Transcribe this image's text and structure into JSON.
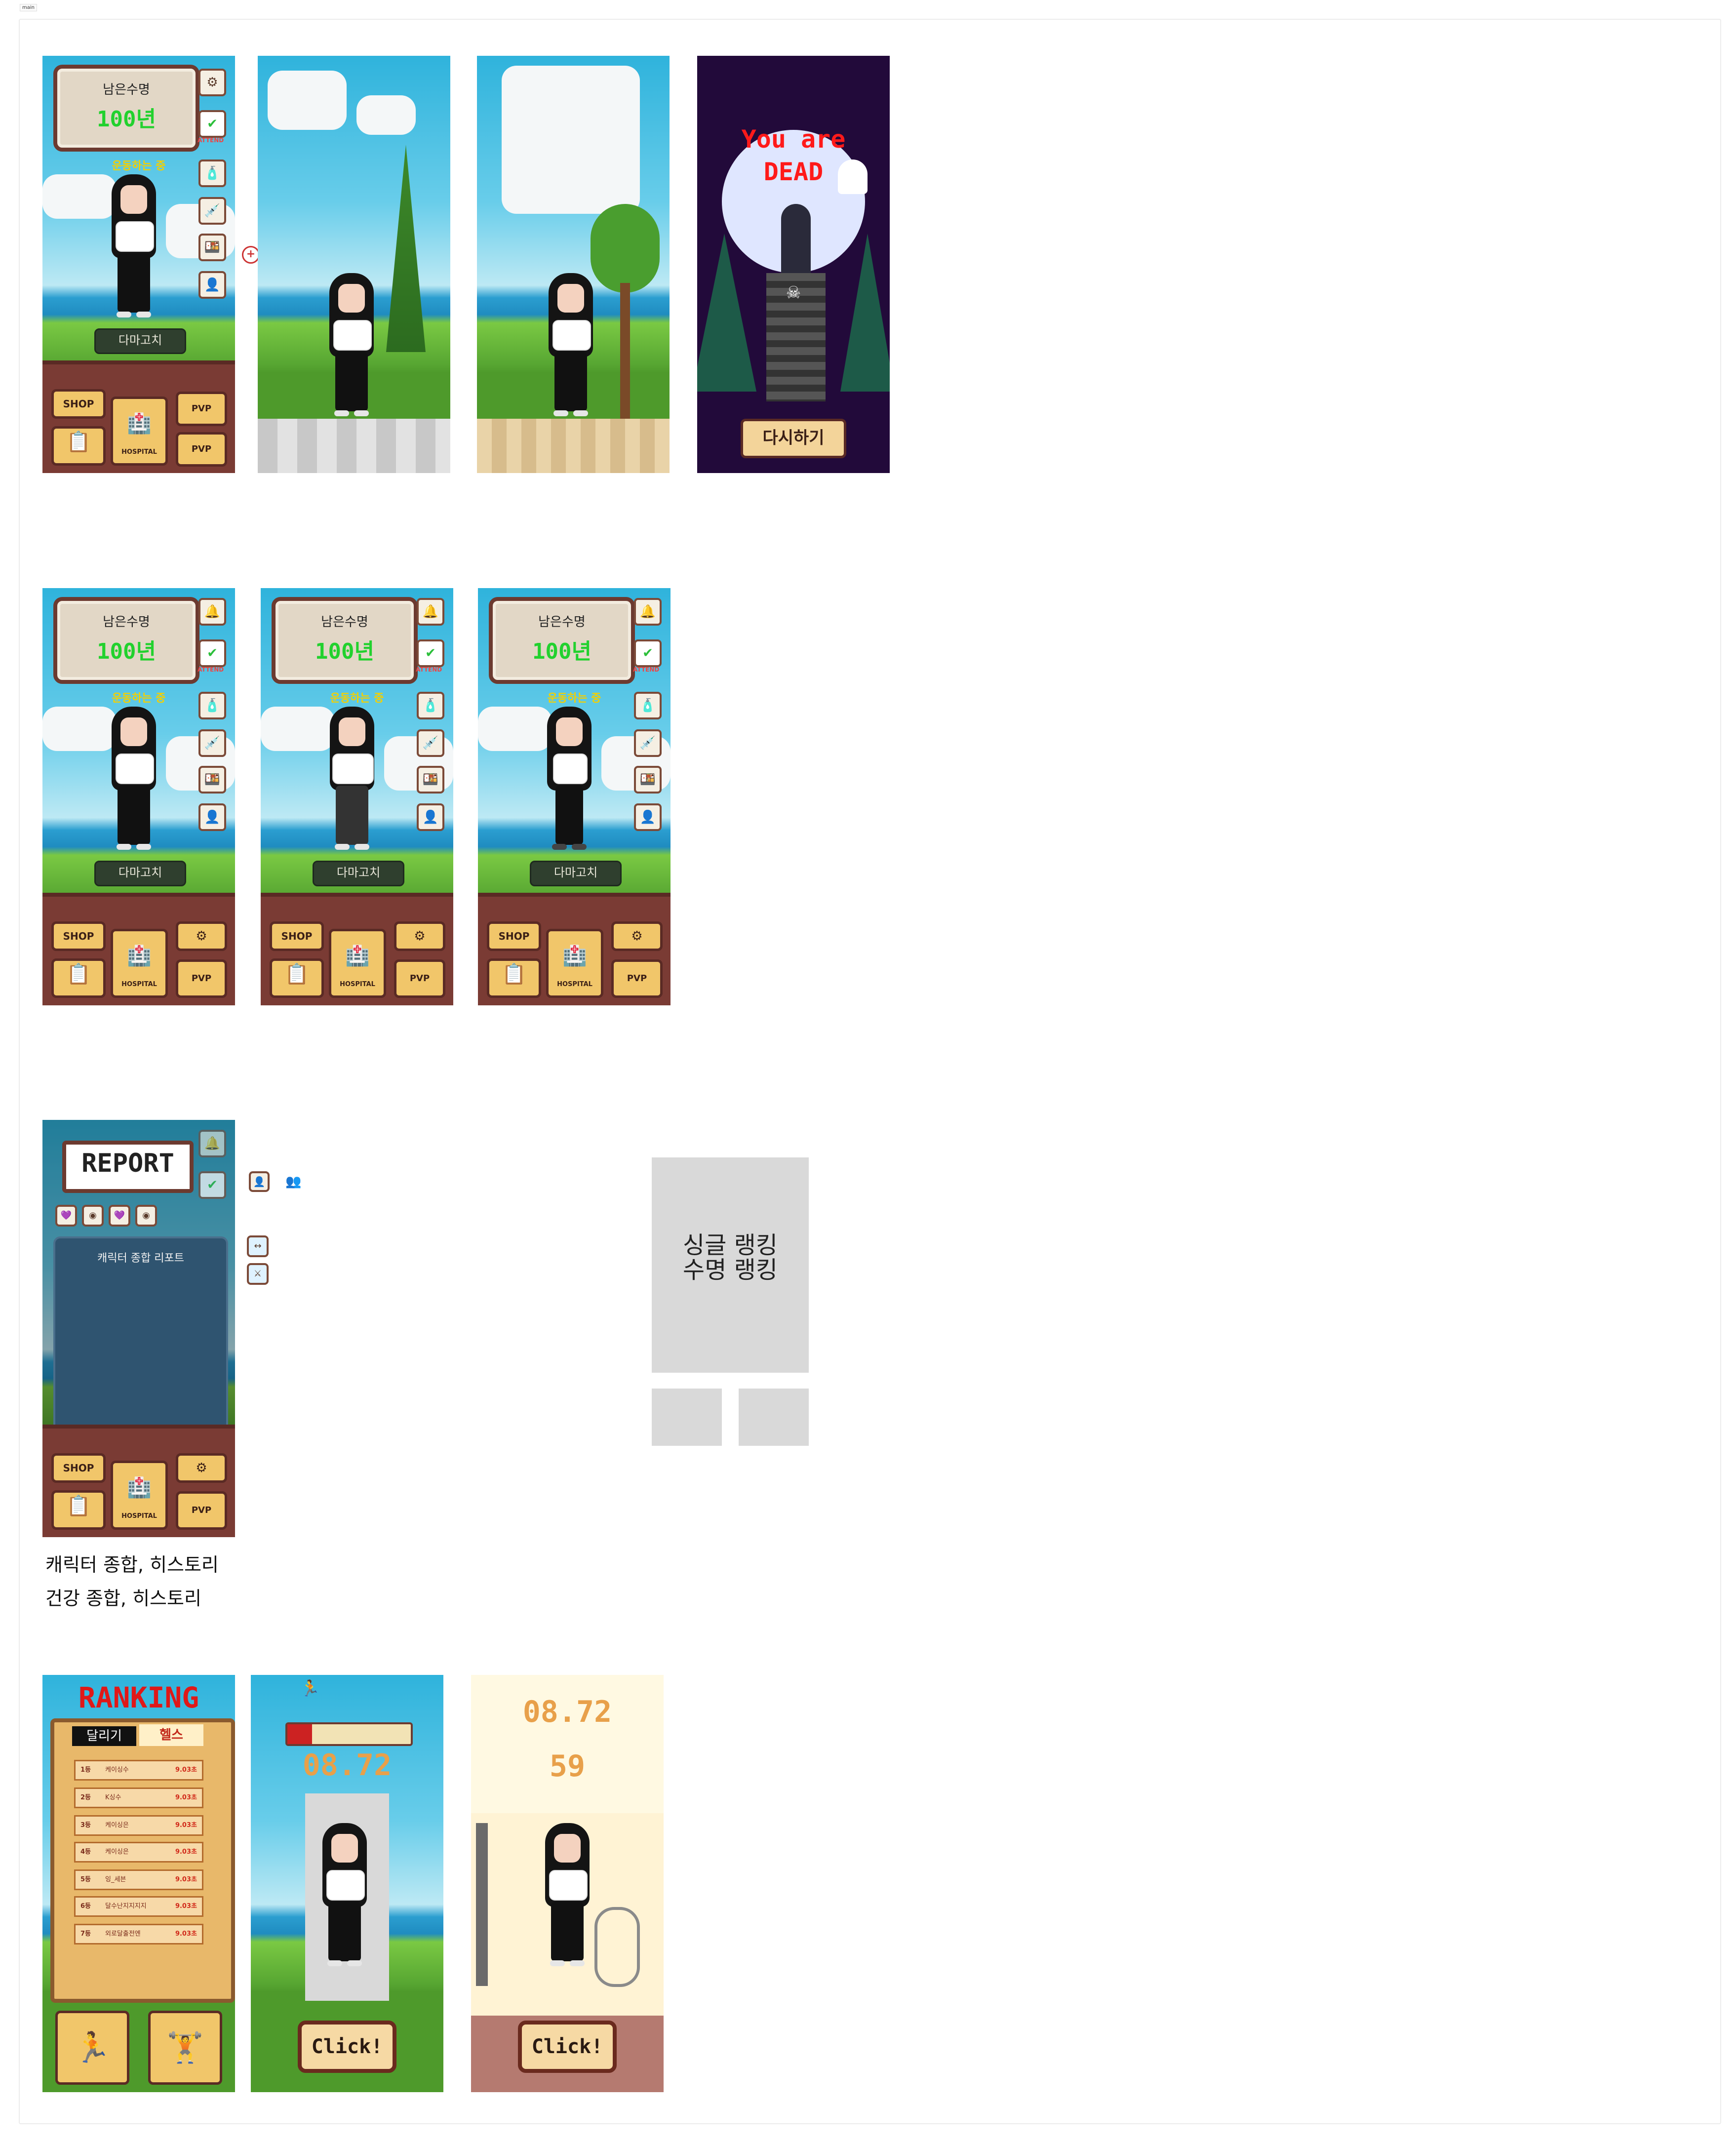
{
  "page": {
    "frame_label": "main"
  },
  "home": {
    "life_label": "남은수명",
    "life_value": "100년",
    "attend": "ATTEND",
    "walking": "운동하는 중",
    "character_name": "다마고치",
    "shop": "SHOP",
    "hospital": "HOSPITAL",
    "pvp": "PVP",
    "report_small": "REPORT"
  },
  "dead_screen": {
    "title_line1": "You are",
    "title_line2": "DEAD",
    "retry": "다시하기"
  },
  "report_screen": {
    "banner": "REPORT",
    "panel_title": "캐릭터 종합 리포트"
  },
  "captions": {
    "line1": "캐릭터 종합, 히스토리",
    "line2": "건강 종합, 히스토리"
  },
  "ranking_cards": {
    "line1": "싱글 랭킹",
    "line2": "수명 랭킹"
  },
  "ranking": {
    "title": "RANKING",
    "tabs": [
      "달리기",
      "헬스"
    ],
    "rows": [
      {
        "rank": "1등",
        "name": "케이싱수",
        "score": "9.03초"
      },
      {
        "rank": "2등",
        "name": "K싱수",
        "score": "9.03초"
      },
      {
        "rank": "3등",
        "name": "케이싱은",
        "score": "9.03초"
      },
      {
        "rank": "4등",
        "name": "케이싱은",
        "score": "9.03초"
      },
      {
        "rank": "5등",
        "name": "잉_세븐",
        "score": "9.03초"
      },
      {
        "rank": "6등",
        "name": "달수난지지지지",
        "score": "9.03초"
      },
      {
        "rank": "7등",
        "name": "외로달출전엔",
        "score": "9.03초"
      }
    ]
  },
  "minigame": {
    "timer": "08.72",
    "count": "59",
    "click": "Click!"
  },
  "colors": {
    "life_green": "#22d12e",
    "frame_brown": "#6c3a30",
    "button_gold": "#f1c66a"
  }
}
